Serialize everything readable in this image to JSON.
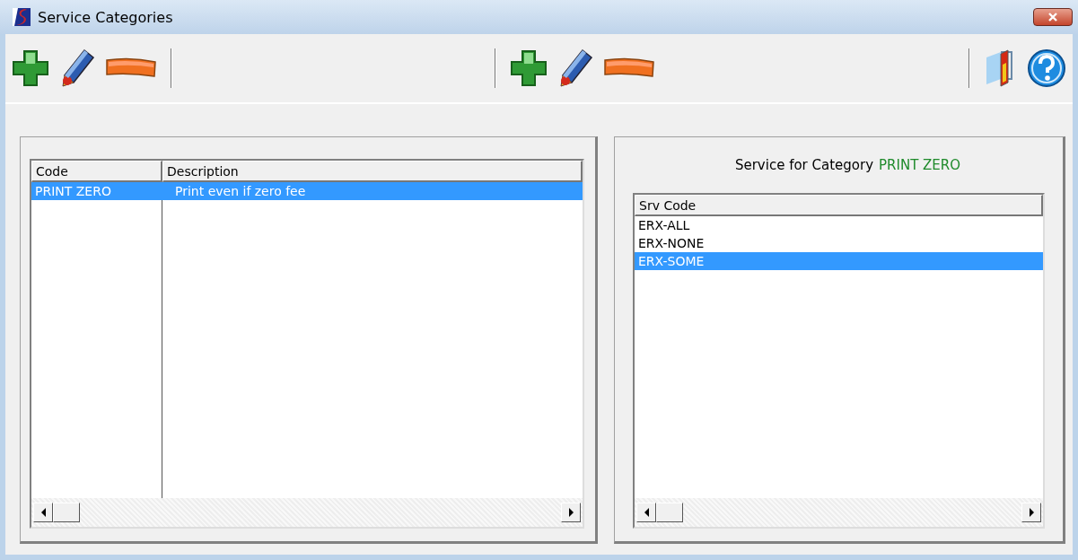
{
  "window": {
    "title": "Service Categories"
  },
  "left_toolbar": [
    {
      "kind": "add"
    },
    {
      "kind": "edit"
    },
    {
      "kind": "delete"
    }
  ],
  "right_toolbar": [
    {
      "kind": "add"
    },
    {
      "kind": "edit"
    },
    {
      "kind": "delete"
    }
  ],
  "end_toolbar": [
    {
      "kind": "exit"
    },
    {
      "kind": "help"
    }
  ],
  "categories": {
    "columns": [
      "Code",
      "Description"
    ],
    "rows": [
      {
        "code": "PRINT ZERO",
        "description": "Print even if zero fee",
        "selected": true
      }
    ]
  },
  "services": {
    "caption": "Service for Category",
    "category": "PRINT ZERO",
    "columns": [
      "Srv Code"
    ],
    "rows": [
      {
        "code": "ERX-ALL",
        "selected": false
      },
      {
        "code": "ERX-NONE",
        "selected": false
      },
      {
        "code": "ERX-SOME",
        "selected": true
      }
    ]
  }
}
